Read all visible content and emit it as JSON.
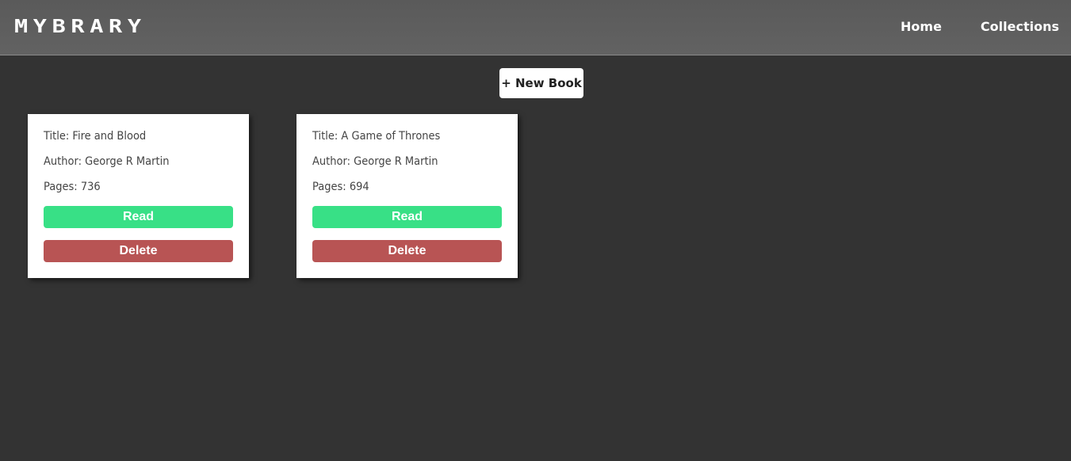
{
  "header": {
    "logo_text": "MYBRARY",
    "nav": {
      "home_label": "Home",
      "collections_label": "Collections"
    }
  },
  "toolbar": {
    "new_book_label": "+ New Book"
  },
  "books": [
    {
      "title_line": "Title: Fire and Blood",
      "author_line": "Author: George R Martin",
      "pages_line": "Pages: 736",
      "read_label": "Read",
      "delete_label": "Delete"
    },
    {
      "title_line": "Title: A Game of Thrones",
      "author_line": "Author: George R Martin",
      "pages_line": "Pages: 694",
      "read_label": "Read",
      "delete_label": "Delete"
    }
  ],
  "colors": {
    "page_background": "#333333",
    "header_background": "#5f5f5f",
    "read_button": "#38e086",
    "delete_button": "#b85454",
    "card_background": "#ffffff"
  }
}
